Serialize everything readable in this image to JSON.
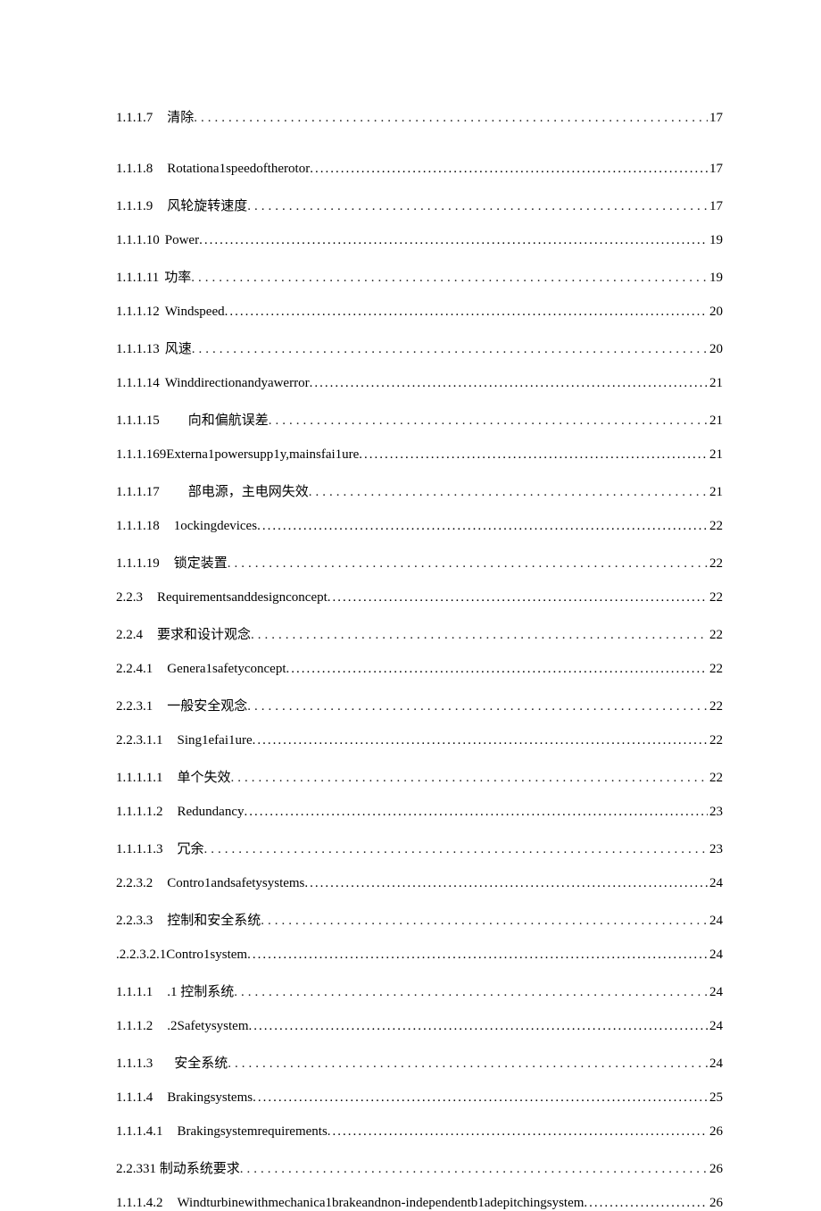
{
  "entries": [
    {
      "num": "1.1.1.7",
      "gap": 16,
      "title": "清除",
      "page": "17",
      "wide": true
    },
    {
      "num": "1.1.1.8",
      "gap": 16,
      "title": "Rotationa1speedoftherotor",
      "page": "17",
      "wide": false
    },
    {
      "num": "1.1.1.9",
      "gap": 16,
      "title": "风轮旋转速度",
      "page": "17",
      "wide": true
    },
    {
      "num": "1.1.1.10",
      "gap": 6,
      "title": "Power",
      "page": "19",
      "wide": false
    },
    {
      "num": "1.1.1.11",
      "gap": 6,
      "title": "功率",
      "page": "19",
      "wide": true
    },
    {
      "num": "1.1.1.12",
      "gap": 6,
      "title": "Windspeed",
      "page": "20",
      "wide": false
    },
    {
      "num": "1.1.1.13",
      "gap": 6,
      "title": "风速",
      "page": "20",
      "wide": true
    },
    {
      "num": "1.1.1.14",
      "gap": 6,
      "title": "Winddirectionandyawerror",
      "page": "21",
      "wide": false
    },
    {
      "num": "1.1.1.15",
      "gap": 32,
      "title": "向和偏航误差",
      "page": "21",
      "wide": true
    },
    {
      "num": "1.1.1.169Externa1powersupp1y,mainsfai1ure",
      "gap": 0,
      "title": "",
      "page": "21",
      "wide": false
    },
    {
      "num": "1.1.1.17",
      "gap": 32,
      "title": "部电源，主电网失效",
      "page": "21",
      "wide": true
    },
    {
      "num": "1.1.1.18",
      "gap": 16,
      "title": "1ockingdevices",
      "page": "22",
      "wide": false
    },
    {
      "num": "1.1.1.19",
      "gap": 16,
      "title": "锁定装置",
      "page": "22",
      "wide": true
    },
    {
      "num": "2.2.3",
      "gap": 16,
      "title": "Requirementsanddesignconcept",
      "page": "22",
      "wide": false
    },
    {
      "num": "2.2.4",
      "gap": 16,
      "title": "要求和设计观念",
      "page": "22",
      "wide": true
    },
    {
      "num": "2.2.4.1",
      "gap": 16,
      "title": "Genera1safetyconcept",
      "page": "22",
      "wide": false
    },
    {
      "num": "2.2.3.1",
      "gap": 16,
      "title": "一般安全观念",
      "page": "22",
      "wide": true
    },
    {
      "num": "2.2.3.1.1",
      "gap": 16,
      "title": "Sing1efai1ure",
      "page": "22",
      "wide": false
    },
    {
      "num": "1.1.1.1.1",
      "gap": 16,
      "title": "单个失效",
      "page": "22",
      "wide": true
    },
    {
      "num": "1.1.1.1.2",
      "gap": 16,
      "title": "Redundancy",
      "page": "23",
      "wide": false
    },
    {
      "num": "1.1.1.1.3",
      "gap": 16,
      "title": "冗余",
      "page": "23",
      "wide": true
    },
    {
      "num": "2.2.3.2",
      "gap": 16,
      "title": "Contro1andsafetysystems",
      "page": "24",
      "wide": false
    },
    {
      "num": "2.2.3.3",
      "gap": 16,
      "title": "控制和安全系统",
      "page": "24",
      "wide": true
    },
    {
      "num": ".2.2.3.2.1Contro1system",
      "gap": 0,
      "title": "",
      "page": "24",
      "wide": false
    },
    {
      "num": "1.1.1.1",
      "gap": 16,
      "title": ".1 控制系统",
      "page": "24",
      "wide": true
    },
    {
      "num": "1.1.1.2",
      "gap": 16,
      "title": ".2Safetysystem",
      "page": "24",
      "wide": false
    },
    {
      "num": "1.1.1.3",
      "gap": 24,
      "title": "安全系统",
      "page": "24",
      "wide": true
    },
    {
      "num": "1.1.1.4",
      "gap": 16,
      "title": "Brakingsystems",
      "page": "25",
      "wide": false
    },
    {
      "num": "1.1.1.4.1",
      "gap": 16,
      "title": "Brakingsystemrequirements",
      "page": "26",
      "wide": false
    },
    {
      "num": "2.2.331 制动系统要求",
      "gap": 0,
      "title": "",
      "page": "26",
      "wide": true
    },
    {
      "num": "1.1.1.4.2",
      "gap": 16,
      "title": "Windturbinewithmechanica1brakeandnon-independentb1adepitchingsystem",
      "page": "26",
      "wide": false
    }
  ]
}
